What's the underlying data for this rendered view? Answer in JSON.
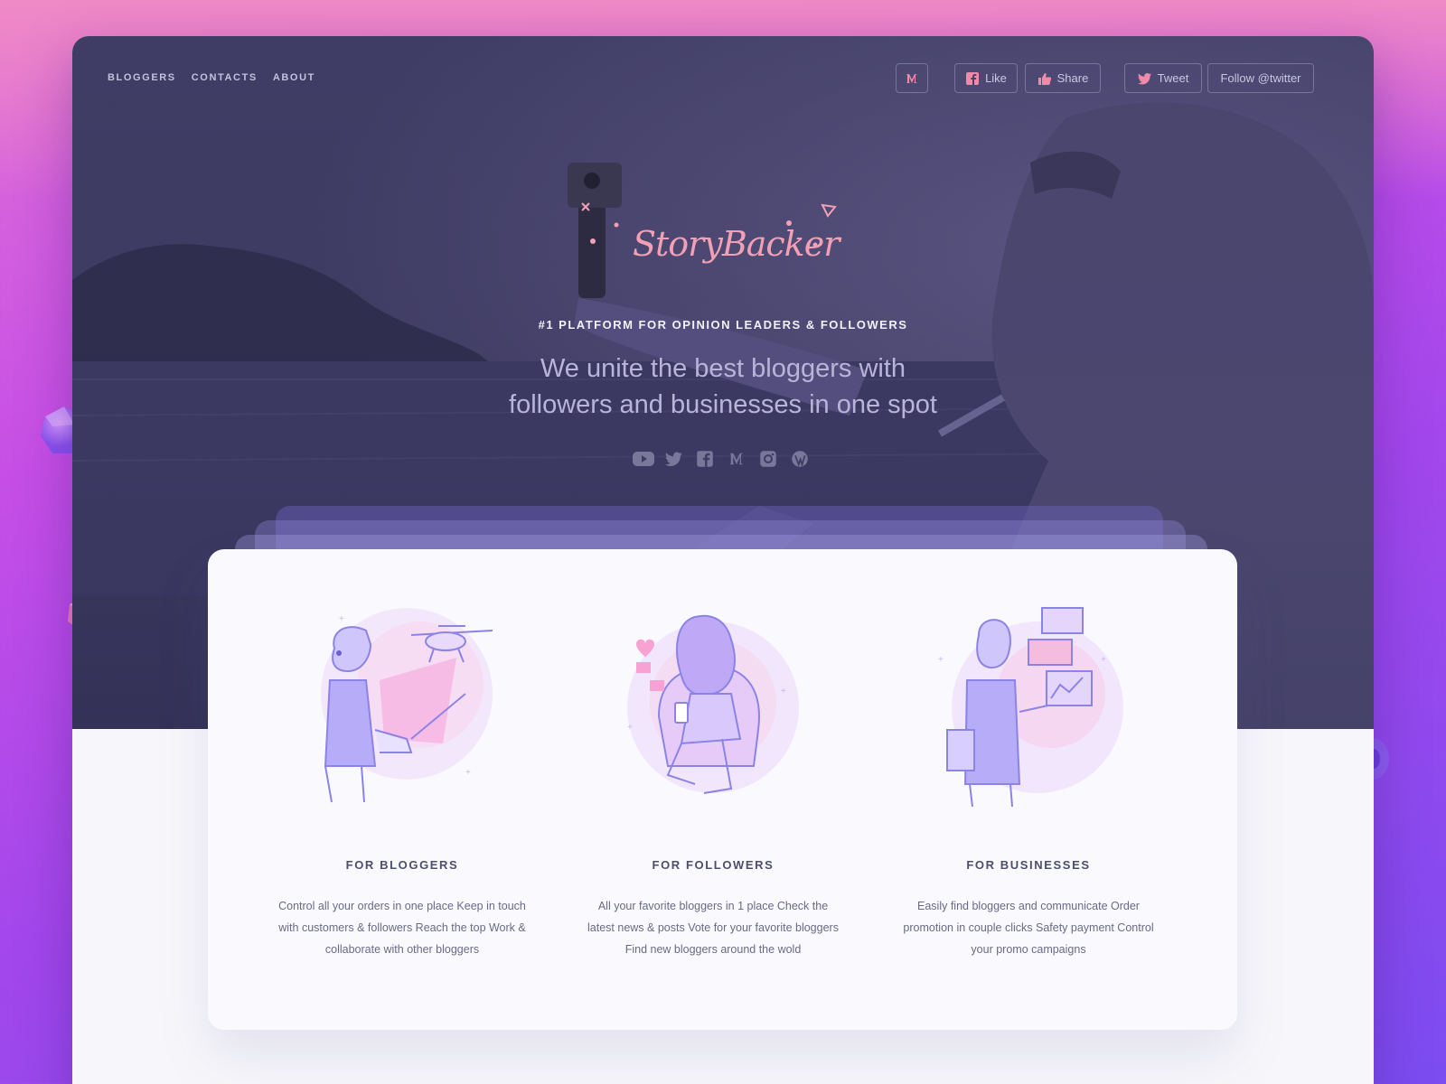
{
  "nav": {
    "items": [
      "BLOGGERS",
      "CONTACTS",
      "ABOUT"
    ]
  },
  "social": {
    "medium_icon": "medium-icon",
    "like_label": "Like",
    "share_label": "Share",
    "tweet_label": "Tweet",
    "follow_label": "Follow @twitter"
  },
  "hero": {
    "logo": "StoryBacker",
    "tagline": "#1 PLATFORM FOR OPINION LEADERS & FOLLOWERS",
    "headline_line1": "We unite the best bloggers with",
    "headline_line2": "followers and businesses in one spot",
    "icons": [
      "youtube-icon",
      "twitter-icon",
      "facebook-icon",
      "medium-icon",
      "instagram-icon",
      "wordpress-icon"
    ]
  },
  "features": [
    {
      "title": "FOR BLOGGERS",
      "text": "Control all your orders in one place Keep in touch with customers & followers Reach the top Work & collaborate with other bloggers"
    },
    {
      "title": "FOR FOLLOWERS",
      "text": "All your favorite bloggers in 1 place Check the latest news & posts Vote for your favorite bloggers Find new bloggers around the wold"
    },
    {
      "title": "FOR BUSINESSES",
      "text": "Easily find bloggers and communicate Order promotion in couple clicks Safety payment Control your promo campaigns"
    }
  ],
  "colors": {
    "accent": "#f3a0b4",
    "hero_bg": "#3f3c63",
    "illustration": "#8b83e6"
  }
}
